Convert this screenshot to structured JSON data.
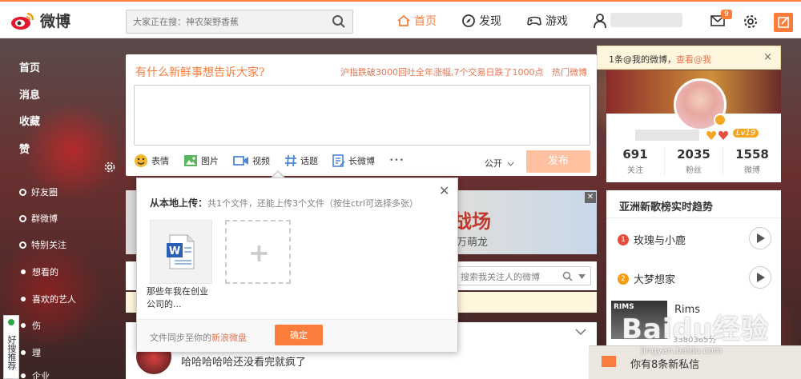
{
  "header": {
    "logo_text": "微博",
    "search_placeholder": "大家正在搜：神农架野香蕉",
    "nav": [
      {
        "label": "首页",
        "active": true
      },
      {
        "label": "发现",
        "active": false
      },
      {
        "label": "游戏",
        "active": false
      }
    ],
    "message_badge": "9"
  },
  "sidebar": {
    "main": [
      "首页",
      "消息",
      "收藏",
      "赞"
    ],
    "groups": [
      {
        "label": "好友圈",
        "type": "ring"
      },
      {
        "label": "群微博",
        "type": "ring"
      },
      {
        "label": "特别关注",
        "type": "ring"
      },
      {
        "label": "想看的",
        "type": "dot"
      },
      {
        "label": "喜欢的艺人",
        "type": "dot"
      },
      {
        "label": "伤",
        "type": "dot"
      },
      {
        "label": "理",
        "type": "dot"
      },
      {
        "label": "企业",
        "type": "dot"
      }
    ],
    "good_recommend": "好搜推荐"
  },
  "publisher": {
    "title": "有什么新鲜事想告诉大家?",
    "hot_text": "沪指跌破3000回吐全年涨幅,7个交易日跌了1000点",
    "hot_topic": "热门微博",
    "tools": [
      {
        "label": "表情",
        "icon": "emoji-icon"
      },
      {
        "label": "图片",
        "icon": "image-icon"
      },
      {
        "label": "视频",
        "icon": "video-icon"
      },
      {
        "label": "话题",
        "icon": "topic-icon"
      },
      {
        "label": "长微博",
        "icon": "long-weibo-icon"
      }
    ],
    "more": "•••",
    "visibility": "公开",
    "send": "发布"
  },
  "upload_popup": {
    "heading": "从本地上传：",
    "info": "共1个文件，还能上传3个文件（按住ctrl可选择多张）",
    "file_name_line1": "那些年我在创业",
    "file_name_line2": "公司的...",
    "footer_text": "文件同步至你的",
    "footer_link": "新浪微盘",
    "confirm": "确定",
    "close": "✕"
  },
  "feed": {
    "ad_text": "战场",
    "ad_sub": "万萌龙",
    "ad_close": "✕",
    "search_placeholder": "搜索我关注人的微博",
    "post_text": "哈哈哈哈哈还没看完就疯了"
  },
  "right": {
    "notice_text": "1条@我的微博，",
    "notice_link": "查看@我",
    "notice_close": "×",
    "level": "Lv19",
    "stats": [
      {
        "num": "691",
        "label": "关注"
      },
      {
        "num": "2035",
        "label": "粉丝"
      },
      {
        "num": "1558",
        "label": "微博"
      }
    ],
    "trend_title": "亚洲新歌榜实时趋势",
    "songs": [
      {
        "rank": "1",
        "title": "玫瑰与小鹿",
        "color": "#e74c3c"
      },
      {
        "rank": "2",
        "title": "大梦想家",
        "color": "#f39c12"
      }
    ],
    "rims_label": "RIMS",
    "rims_title": "Rims",
    "rims_num": "3380365分",
    "watermark": "Baidu经验",
    "watermark_url": "jingyan.baidu.com",
    "new_msg": "你有8条新私信"
  },
  "colors": {
    "accent": "#fa7d3c",
    "link": "#eb7350"
  }
}
